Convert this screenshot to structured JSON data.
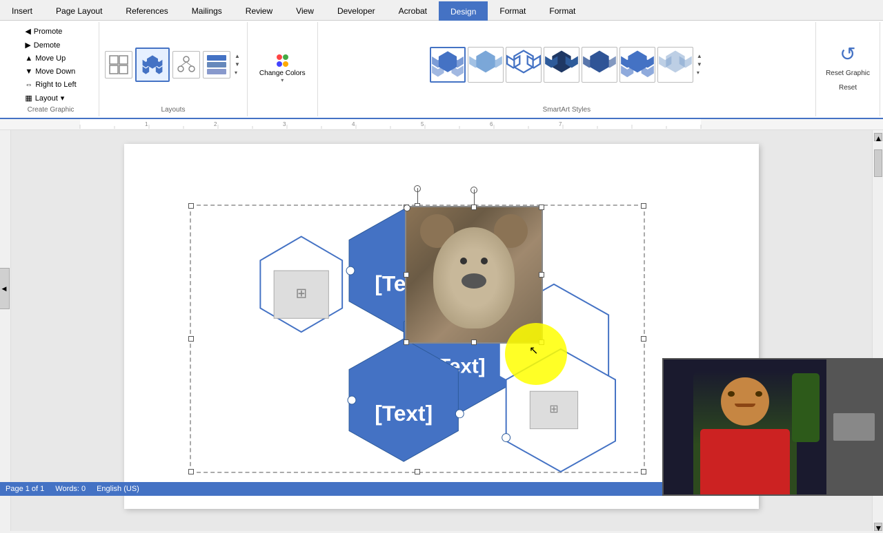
{
  "tabs": {
    "items": [
      {
        "label": "Insert",
        "active": false
      },
      {
        "label": "Page Layout",
        "active": false
      },
      {
        "label": "References",
        "active": false
      },
      {
        "label": "Mailings",
        "active": false
      },
      {
        "label": "Review",
        "active": false
      },
      {
        "label": "View",
        "active": false
      },
      {
        "label": "Developer",
        "active": false
      },
      {
        "label": "Acrobat",
        "active": false
      },
      {
        "label": "Design",
        "active": true,
        "design": true
      },
      {
        "label": "Format",
        "active": false
      },
      {
        "label": "Format",
        "active": false
      }
    ]
  },
  "ribbon": {
    "groups": {
      "create_graphic": {
        "label": "Create Graphic",
        "promote_label": "Promote",
        "demote_label": "Demote",
        "move_up_label": "Move Up",
        "move_down_label": "Move Down",
        "right_to_left_label": "Right to Left",
        "layout_label": "Layout"
      },
      "layouts": {
        "label": "Layouts"
      },
      "change_colors": {
        "label": "Change Colors",
        "dropdown_arrow": "▾"
      },
      "smartart_styles": {
        "label": "SmartArt Styles"
      },
      "reset": {
        "reset_graphic_label": "Reset Graphic",
        "reset_label": "Reset"
      }
    }
  },
  "smartart": {
    "text_items": [
      "[Text]",
      "[Text]",
      "[Text]"
    ],
    "selected_item_text": "[Text]"
  },
  "status": {
    "page_info": "Page 1 of 1",
    "word_count": "Words: 0",
    "language": "English (US)"
  },
  "colors": {
    "hex_fill": "#4472C4",
    "hex_outline": "#2E5B9A",
    "hex_empty_stroke": "#4472C4",
    "accent": "#4472C4",
    "yellow_highlight": "#FFFF00"
  }
}
